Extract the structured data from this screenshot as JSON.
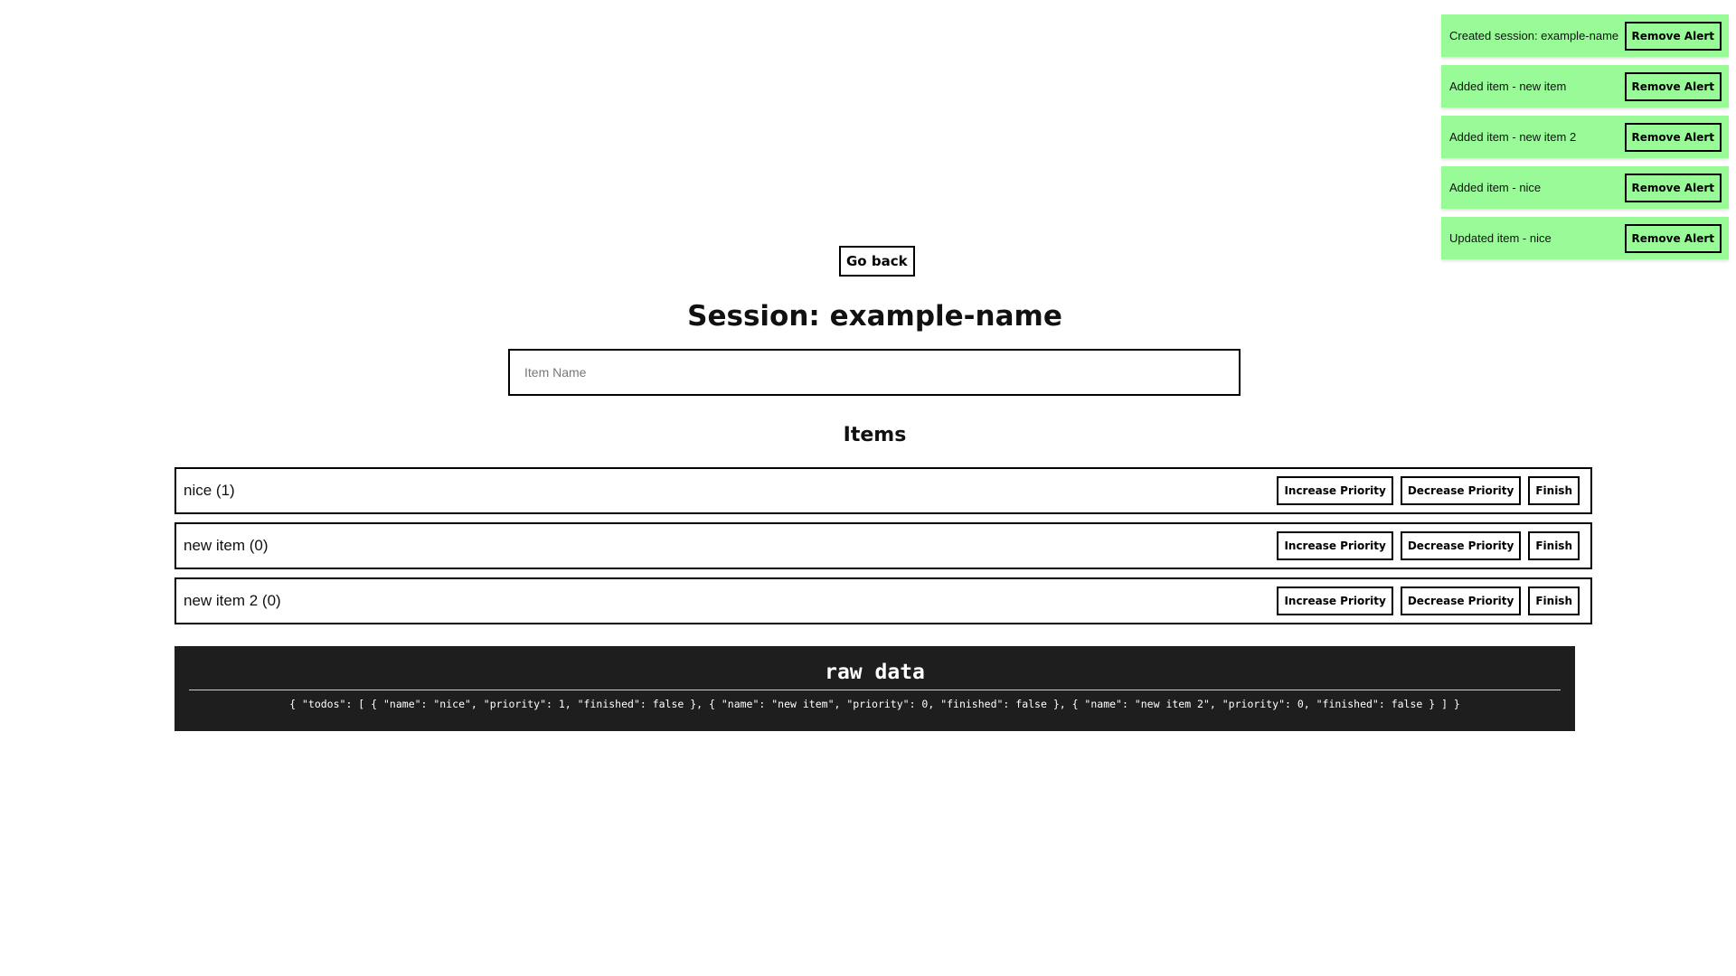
{
  "alerts": [
    {
      "text": "Created session: example-name",
      "button_label": "Remove Alert"
    },
    {
      "text": "Added item - new item",
      "button_label": "Remove Alert"
    },
    {
      "text": "Added item - new item 2",
      "button_label": "Remove Alert"
    },
    {
      "text": "Added item - nice",
      "button_label": "Remove Alert"
    },
    {
      "text": "Updated item - nice",
      "button_label": "Remove Alert"
    }
  ],
  "header": {
    "go_back_label": "Go back",
    "session_title": "Session: example-name",
    "item_input": {
      "placeholder": "Item Name",
      "value": ""
    }
  },
  "items_section": {
    "heading": "Items",
    "increase_label": "Increase Priority",
    "decrease_label": "Decrease Priority",
    "finish_label": "Finish",
    "rows": [
      {
        "label": "nice (1)"
      },
      {
        "label": "new item (0)"
      },
      {
        "label": "new item 2 (0)"
      }
    ]
  },
  "raw_data": {
    "title": "raw data",
    "json_text": "{ \"todos\": [ { \"name\": \"nice\", \"priority\": 1, \"finished\": false }, { \"name\": \"new item\", \"priority\": 0, \"finished\": false }, { \"name\": \"new item 2\", \"priority\": 0, \"finished\": false } ] }"
  },
  "colors": {
    "alert_background": "#98fb98",
    "raw_panel_background": "#1e1e1e",
    "border": "#000000"
  }
}
